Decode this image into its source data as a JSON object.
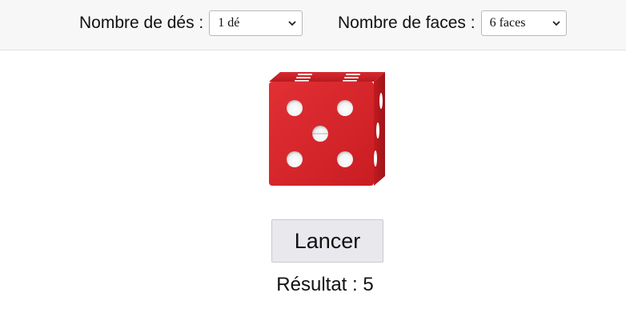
{
  "controls": {
    "dice_count": {
      "label": "Nombre de dés :",
      "selected": "1 dé"
    },
    "faces": {
      "label": "Nombre de faces :",
      "selected": "6 faces"
    }
  },
  "die": {
    "color": "#d9252a",
    "shown_value": 5
  },
  "roll_button": {
    "label": "Lancer"
  },
  "result": {
    "text": "Résultat : 5"
  }
}
